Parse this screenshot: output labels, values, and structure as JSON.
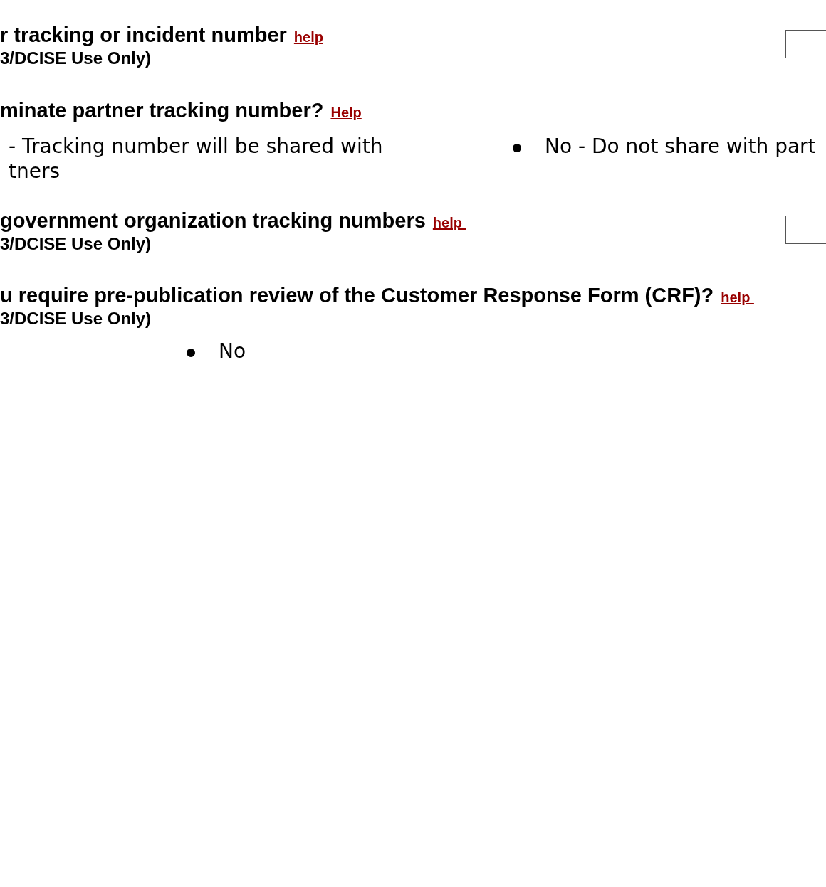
{
  "questions": [
    {
      "kind": "text",
      "title": "r tracking or incident number",
      "help": "help",
      "note": "3/DCISE Use Only)"
    },
    {
      "kind": "choice",
      "title": "minate partner tracking number?",
      "help": "Help",
      "options": [
        {
          "lines": [
            "- Tracking number will be shared with",
            "tners"
          ]
        },
        {
          "lines": [
            "No - Do not share with part"
          ]
        }
      ]
    },
    {
      "kind": "text",
      "title": "government organization tracking numbers",
      "help": "help ",
      "note": "3/DCISE Use Only)"
    },
    {
      "kind": "choice",
      "title": "u require pre-publication review of the Customer Response Form (CRF)?",
      "help": "help ",
      "note": "3/DCISE Use Only)",
      "options": [
        {
          "lines": [
            "No"
          ]
        }
      ]
    }
  ]
}
